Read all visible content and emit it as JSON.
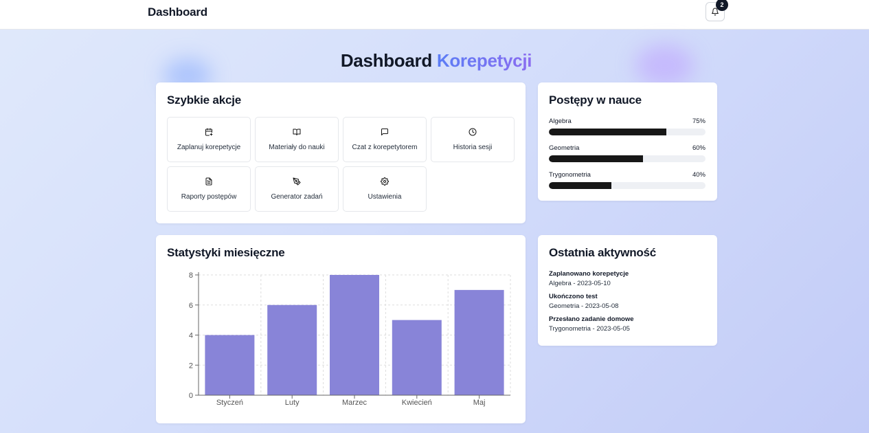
{
  "topbar": {
    "title": "Dashboard",
    "notifications_count": "2"
  },
  "hero": {
    "title_main": "Dashboard",
    "title_accent": "Korepetycji"
  },
  "quick_actions": {
    "title": "Szybkie akcje",
    "items": [
      {
        "label": "Zaplanuj korepetycje",
        "icon": "calendar-plus-icon"
      },
      {
        "label": "Materiały do nauki",
        "icon": "book-icon"
      },
      {
        "label": "Czat z korepetytorem",
        "icon": "chat-icon"
      },
      {
        "label": "Historia sesji",
        "icon": "clock-icon"
      },
      {
        "label": "Raporty postępów",
        "icon": "file-text-icon"
      },
      {
        "label": "Generator zadań",
        "icon": "pen-tool-icon"
      },
      {
        "label": "Ustawienia",
        "icon": "gear-icon"
      }
    ]
  },
  "progress": {
    "title": "Postępy w nauce",
    "items": [
      {
        "subject": "Algebra",
        "percent_label": "75%",
        "value": 0.75
      },
      {
        "subject": "Geometria",
        "percent_label": "60%",
        "value": 0.6
      },
      {
        "subject": "Trygonometria",
        "percent_label": "40%",
        "value": 0.4
      }
    ]
  },
  "stats": {
    "title": "Statystyki miesięczne"
  },
  "activity": {
    "title": "Ostatnia aktywność",
    "items": [
      {
        "title": "Zaplanowano korepetycje",
        "detail": "Algebra - 2023-05-10"
      },
      {
        "title": "Ukończono test",
        "detail": "Geometria - 2023-05-08"
      },
      {
        "title": "Przesłano zadanie domowe",
        "detail": "Trygonometria - 2023-05-05"
      }
    ]
  },
  "colors": {
    "bar": "#8884d8",
    "accent_start": "#5b7df5",
    "accent_end": "#8b6cf0",
    "progress_fill": "#171717"
  },
  "chart_data": {
    "type": "bar",
    "categories": [
      "Styczeń",
      "Luty",
      "Marzec",
      "Kwiecień",
      "Maj"
    ],
    "values": [
      4,
      6,
      8,
      5,
      7
    ],
    "yticks": [
      0,
      2,
      4,
      6,
      8
    ],
    "ylim": [
      0,
      8
    ],
    "grid": true,
    "title": "Statystyki miesięczne",
    "xlabel": "",
    "ylabel": ""
  }
}
